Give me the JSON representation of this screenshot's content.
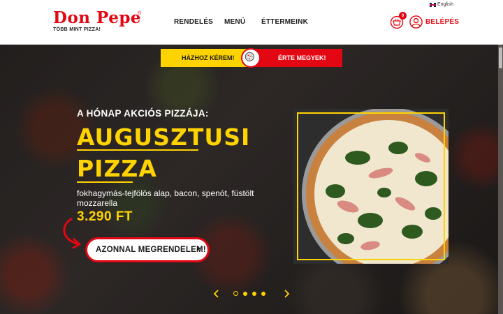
{
  "brand": {
    "name": "Don Pepe",
    "registered": "®",
    "tagline": "TÖBB MINT PIZZA!"
  },
  "header": {
    "nav": [
      "RENDELÉS",
      "MENÜ",
      "ÉTTERMEINK"
    ],
    "language": "English",
    "cart_count": "0",
    "login_label": "BELÉPÉS"
  },
  "order_bar": {
    "home_label": "HÁZHOZ KÉREM!",
    "pickup_label": "ÉRTE MEGYEK!"
  },
  "hero": {
    "kicker": "A HÓNAP AKCIÓS PIZZÁJA:",
    "title_line1": "AUGUSZTUSI",
    "title_line2": "PIZZA",
    "description": "fokhagymás-tejfölös alap, bacon, spenót, füstölt mozzarella",
    "price": "3.290 FT",
    "cta_label": "AZONNAL MEGRENDELEM!"
  },
  "slider": {
    "slide_count": 4,
    "active_index": 0
  },
  "colors": {
    "brand_red": "#e30613",
    "accent_yellow": "#ffd300",
    "text_dark": "#1a1a1a"
  },
  "icons": [
    "flag-uk-icon",
    "basket-icon",
    "user-icon",
    "pizza-icon",
    "chevron-right-icon",
    "curved-arrow-icon",
    "slider-prev-icon",
    "slider-next-icon"
  ]
}
